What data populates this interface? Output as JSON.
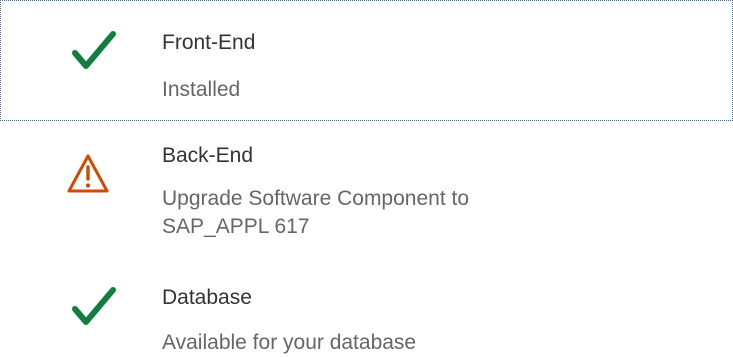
{
  "items": [
    {
      "icon": "checkmark-icon",
      "title": "Front-End",
      "status_lines": [
        "Installed"
      ],
      "icon_color": "#107E3E",
      "focused": true
    },
    {
      "icon": "warning-triangle-icon",
      "title": "Back-End",
      "status_lines": [
        "Upgrade Software Component to",
        "SAP_APPL 617"
      ],
      "icon_color": "#D04A02",
      "focused": false
    },
    {
      "icon": "checkmark-icon",
      "title": "Database",
      "status_lines": [
        "Available for your database"
      ],
      "icon_color": "#107E3E",
      "focused": false
    }
  ],
  "colors": {
    "focus_outline": "#4A6F95",
    "title_text": "#333333",
    "status_text": "#666666"
  }
}
